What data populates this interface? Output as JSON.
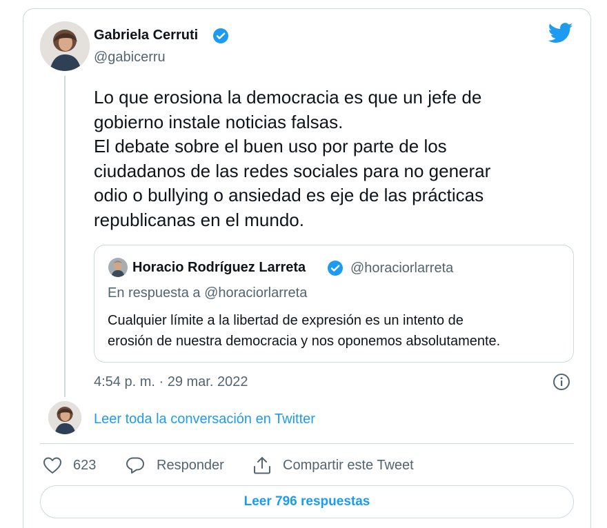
{
  "tweet": {
    "author": {
      "name": "Gabriela Cerruti",
      "handle": "@gabicerru",
      "verified": true
    },
    "text": "Lo que erosiona la democracia es que un jefe de\ngobierno instale noticias falsas.\nEl debate sobre el buen uso por parte de los\nciudadanos de las redes sociales para no generar\nodio o bullying o ansiedad es eje de las prácticas\nrepublicanas en el mundo.",
    "timestamp": "4:54 p. m. · 29 mar. 2022"
  },
  "quoted_tweet": {
    "name": "Horacio Rodríguez Larreta",
    "handle": "@horaciorlarreta",
    "verified": true,
    "reply_to": "En respuesta a @horaciorlarreta",
    "text": "Cualquier límite a la libertad de expresión es un intento de\nerosión de nuestra democracia y nos oponemos absolutamente."
  },
  "read_conversation": "Leer toda la conversación en Twitter",
  "actions": {
    "like_count": "623",
    "reply_label": "Responder",
    "share_label": "Compartir este Tweet"
  },
  "read_replies": "Leer 796 respuestas",
  "colors": {
    "accent": "#1d9bf0",
    "text": "#0f1419",
    "secondary": "#536471",
    "border": "#cfd9de"
  },
  "icons": [
    "twitter-bird-icon",
    "verified-badge-icon",
    "info-icon",
    "heart-icon",
    "reply-bubble-icon",
    "share-icon"
  ]
}
